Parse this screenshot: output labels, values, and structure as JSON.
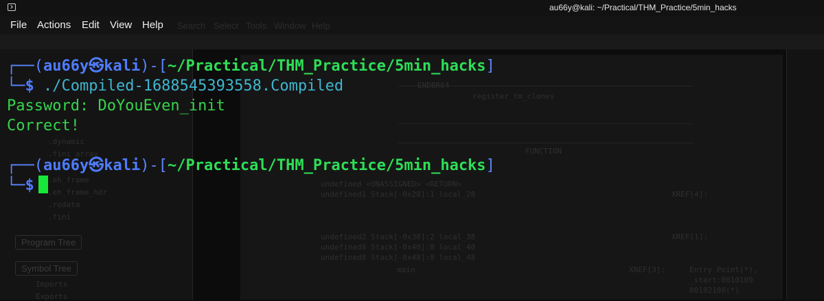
{
  "window": {
    "title": "au66y@kali: ~/Practical/THM_Practice/5min_hacks"
  },
  "menubar": {
    "items": [
      "File",
      "Actions",
      "Edit",
      "View",
      "Help"
    ]
  },
  "background_app": {
    "menu_items": [
      "Search",
      "Select",
      "Tools",
      "Window",
      "Help"
    ],
    "tabs": [
      "Program Tree",
      "Symbol Tree"
    ],
    "tree_items": [
      ".dynamic",
      ".fini_array",
      ".eh_frame",
      ".eh_frame_hdr",
      ".rodata",
      ".fini"
    ],
    "symbol_items": [
      "Imports",
      "Exports"
    ],
    "listing": [
      "ENDBR64",
      "register_tm_clones",
      "FUNCTION",
      "undefined     <UNASSIGNED>  <RETURN>",
      "undefined1    Stack[-0x28]:1 local_28",
      "undefined2    Stack[-0x38]:2 local_38",
      "undefined8    Stack[-0x40]:8 local_40",
      "undefined8    Stack[-0x48]:8 local_48",
      "main",
      "XREF[4]:",
      "XREF[1]:",
      "XREF[3]:",
      "Entry Point(*),",
      "_start:0010109",
      "00102108(*)"
    ]
  },
  "terminal": {
    "prompt_user": "au66y",
    "prompt_symbol": "㉿",
    "prompt_host": "kali",
    "prompt_path": "~/Practical/THM_Practice/5min_hacks",
    "prompt_dollar": "$",
    "command": "./Compiled-1688545393558.Compiled",
    "output": [
      "Password: DoYouEven_init",
      "Correct!"
    ]
  },
  "colors": {
    "prompt_frame": "#4f7cff",
    "prompt_host_path": "#2ede57",
    "command": "#3fb6d0",
    "output": "#36d44c",
    "cursor": "#19e63a"
  }
}
